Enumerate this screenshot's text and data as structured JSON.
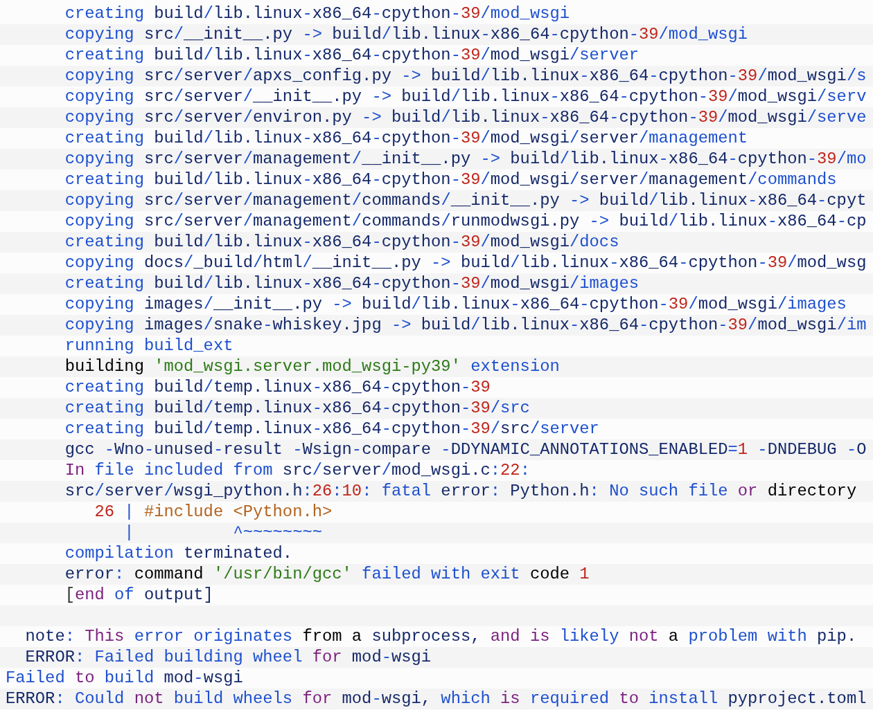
{
  "lines": [
    {
      "kind": "code",
      "tokens": [
        {
          "text": "      creating",
          "color": "#1d50cf"
        },
        {
          "text": " build",
          "color": "#15296a"
        },
        {
          "text": "/",
          "color": "#1d50cf"
        },
        {
          "text": "lib.linux",
          "color": "#15296a"
        },
        {
          "text": "-",
          "color": "#1d50cf"
        },
        {
          "text": "x86_64",
          "color": "#15296a"
        },
        {
          "text": "-",
          "color": "#1d50cf"
        },
        {
          "text": "cpython",
          "color": "#15296a"
        },
        {
          "text": "-",
          "color": "#1d50cf"
        },
        {
          "text": "39",
          "color": "#c0241b"
        },
        {
          "text": "/mod_wsgi",
          "color": "#1d50cf"
        }
      ]
    },
    {
      "kind": "code",
      "tokens": [
        {
          "text": "      copying",
          "color": "#1d50cf"
        },
        {
          "text": " src",
          "color": "#15296a"
        },
        {
          "text": "/",
          "color": "#1d50cf"
        },
        {
          "text": "__init__.py",
          "color": "#15296a"
        },
        {
          "text": " ->",
          "color": "#1d50cf"
        },
        {
          "text": " build",
          "color": "#15296a"
        },
        {
          "text": "/",
          "color": "#1d50cf"
        },
        {
          "text": "lib.linux",
          "color": "#15296a"
        },
        {
          "text": "-",
          "color": "#1d50cf"
        },
        {
          "text": "x86_64",
          "color": "#15296a"
        },
        {
          "text": "-",
          "color": "#1d50cf"
        },
        {
          "text": "cpython",
          "color": "#15296a"
        },
        {
          "text": "-",
          "color": "#1d50cf"
        },
        {
          "text": "39",
          "color": "#c0241b"
        },
        {
          "text": "/mod_wsgi",
          "color": "#1d50cf"
        }
      ]
    },
    {
      "kind": "code",
      "tokens": [
        {
          "text": "      creating",
          "color": "#1d50cf"
        },
        {
          "text": " build",
          "color": "#15296a"
        },
        {
          "text": "/",
          "color": "#1d50cf"
        },
        {
          "text": "lib.linux",
          "color": "#15296a"
        },
        {
          "text": "-",
          "color": "#1d50cf"
        },
        {
          "text": "x86_64",
          "color": "#15296a"
        },
        {
          "text": "-",
          "color": "#1d50cf"
        },
        {
          "text": "cpython",
          "color": "#15296a"
        },
        {
          "text": "-",
          "color": "#1d50cf"
        },
        {
          "text": "39",
          "color": "#c0241b"
        },
        {
          "text": "/",
          "color": "#1d50cf"
        },
        {
          "text": "mod_wsgi",
          "color": "#15296a"
        },
        {
          "text": "/server",
          "color": "#1d50cf"
        }
      ]
    },
    {
      "kind": "code",
      "tokens": [
        {
          "text": "      copying",
          "color": "#1d50cf"
        },
        {
          "text": " src",
          "color": "#15296a"
        },
        {
          "text": "/",
          "color": "#1d50cf"
        },
        {
          "text": "server",
          "color": "#15296a"
        },
        {
          "text": "/",
          "color": "#1d50cf"
        },
        {
          "text": "apxs_config.py",
          "color": "#15296a"
        },
        {
          "text": " ->",
          "color": "#1d50cf"
        },
        {
          "text": " build",
          "color": "#15296a"
        },
        {
          "text": "/",
          "color": "#1d50cf"
        },
        {
          "text": "lib.linux",
          "color": "#15296a"
        },
        {
          "text": "-",
          "color": "#1d50cf"
        },
        {
          "text": "x86_64",
          "color": "#15296a"
        },
        {
          "text": "-",
          "color": "#1d50cf"
        },
        {
          "text": "cpython",
          "color": "#15296a"
        },
        {
          "text": "-",
          "color": "#1d50cf"
        },
        {
          "text": "39",
          "color": "#c0241b"
        },
        {
          "text": "/",
          "color": "#1d50cf"
        },
        {
          "text": "mod_wsgi",
          "color": "#15296a"
        },
        {
          "text": "/s",
          "color": "#1d50cf"
        }
      ]
    },
    {
      "kind": "code",
      "tokens": [
        {
          "text": "      copying",
          "color": "#1d50cf"
        },
        {
          "text": " src",
          "color": "#15296a"
        },
        {
          "text": "/",
          "color": "#1d50cf"
        },
        {
          "text": "server",
          "color": "#15296a"
        },
        {
          "text": "/",
          "color": "#1d50cf"
        },
        {
          "text": "__init__.py",
          "color": "#15296a"
        },
        {
          "text": " ->",
          "color": "#1d50cf"
        },
        {
          "text": " build",
          "color": "#15296a"
        },
        {
          "text": "/",
          "color": "#1d50cf"
        },
        {
          "text": "lib.linux",
          "color": "#15296a"
        },
        {
          "text": "-",
          "color": "#1d50cf"
        },
        {
          "text": "x86_64",
          "color": "#15296a"
        },
        {
          "text": "-",
          "color": "#1d50cf"
        },
        {
          "text": "cpython",
          "color": "#15296a"
        },
        {
          "text": "-",
          "color": "#1d50cf"
        },
        {
          "text": "39",
          "color": "#c0241b"
        },
        {
          "text": "/",
          "color": "#1d50cf"
        },
        {
          "text": "mod_wsgi",
          "color": "#15296a"
        },
        {
          "text": "/serv",
          "color": "#1d50cf"
        }
      ]
    },
    {
      "kind": "code",
      "tokens": [
        {
          "text": "      copying",
          "color": "#1d50cf"
        },
        {
          "text": " src",
          "color": "#15296a"
        },
        {
          "text": "/",
          "color": "#1d50cf"
        },
        {
          "text": "server",
          "color": "#15296a"
        },
        {
          "text": "/",
          "color": "#1d50cf"
        },
        {
          "text": "environ.py",
          "color": "#15296a"
        },
        {
          "text": " ->",
          "color": "#1d50cf"
        },
        {
          "text": " build",
          "color": "#15296a"
        },
        {
          "text": "/",
          "color": "#1d50cf"
        },
        {
          "text": "lib.linux",
          "color": "#15296a"
        },
        {
          "text": "-",
          "color": "#1d50cf"
        },
        {
          "text": "x86_64",
          "color": "#15296a"
        },
        {
          "text": "-",
          "color": "#1d50cf"
        },
        {
          "text": "cpython",
          "color": "#15296a"
        },
        {
          "text": "-",
          "color": "#1d50cf"
        },
        {
          "text": "39",
          "color": "#c0241b"
        },
        {
          "text": "/",
          "color": "#1d50cf"
        },
        {
          "text": "mod_wsgi",
          "color": "#15296a"
        },
        {
          "text": "/serve",
          "color": "#1d50cf"
        }
      ]
    },
    {
      "kind": "code",
      "tokens": [
        {
          "text": "      creating",
          "color": "#1d50cf"
        },
        {
          "text": " build",
          "color": "#15296a"
        },
        {
          "text": "/",
          "color": "#1d50cf"
        },
        {
          "text": "lib.linux",
          "color": "#15296a"
        },
        {
          "text": "-",
          "color": "#1d50cf"
        },
        {
          "text": "x86_64",
          "color": "#15296a"
        },
        {
          "text": "-",
          "color": "#1d50cf"
        },
        {
          "text": "cpython",
          "color": "#15296a"
        },
        {
          "text": "-",
          "color": "#1d50cf"
        },
        {
          "text": "39",
          "color": "#c0241b"
        },
        {
          "text": "/",
          "color": "#1d50cf"
        },
        {
          "text": "mod_wsgi",
          "color": "#15296a"
        },
        {
          "text": "/",
          "color": "#1d50cf"
        },
        {
          "text": "server",
          "color": "#15296a"
        },
        {
          "text": "/management",
          "color": "#1d50cf"
        }
      ]
    },
    {
      "kind": "code",
      "tokens": [
        {
          "text": "      copying",
          "color": "#1d50cf"
        },
        {
          "text": " src",
          "color": "#15296a"
        },
        {
          "text": "/",
          "color": "#1d50cf"
        },
        {
          "text": "server",
          "color": "#15296a"
        },
        {
          "text": "/",
          "color": "#1d50cf"
        },
        {
          "text": "management",
          "color": "#15296a"
        },
        {
          "text": "/",
          "color": "#1d50cf"
        },
        {
          "text": "__init__.py",
          "color": "#15296a"
        },
        {
          "text": " ->",
          "color": "#1d50cf"
        },
        {
          "text": " build",
          "color": "#15296a"
        },
        {
          "text": "/",
          "color": "#1d50cf"
        },
        {
          "text": "lib.linux",
          "color": "#15296a"
        },
        {
          "text": "-",
          "color": "#1d50cf"
        },
        {
          "text": "x86_64",
          "color": "#15296a"
        },
        {
          "text": "-",
          "color": "#1d50cf"
        },
        {
          "text": "cpython",
          "color": "#15296a"
        },
        {
          "text": "-",
          "color": "#1d50cf"
        },
        {
          "text": "39",
          "color": "#c0241b"
        },
        {
          "text": "/mo",
          "color": "#1d50cf"
        }
      ]
    },
    {
      "kind": "code",
      "tokens": [
        {
          "text": "      creating",
          "color": "#1d50cf"
        },
        {
          "text": " build",
          "color": "#15296a"
        },
        {
          "text": "/",
          "color": "#1d50cf"
        },
        {
          "text": "lib.linux",
          "color": "#15296a"
        },
        {
          "text": "-",
          "color": "#1d50cf"
        },
        {
          "text": "x86_64",
          "color": "#15296a"
        },
        {
          "text": "-",
          "color": "#1d50cf"
        },
        {
          "text": "cpython",
          "color": "#15296a"
        },
        {
          "text": "-",
          "color": "#1d50cf"
        },
        {
          "text": "39",
          "color": "#c0241b"
        },
        {
          "text": "/",
          "color": "#1d50cf"
        },
        {
          "text": "mod_wsgi",
          "color": "#15296a"
        },
        {
          "text": "/",
          "color": "#1d50cf"
        },
        {
          "text": "server",
          "color": "#15296a"
        },
        {
          "text": "/",
          "color": "#1d50cf"
        },
        {
          "text": "management",
          "color": "#15296a"
        },
        {
          "text": "/commands",
          "color": "#1d50cf"
        }
      ]
    },
    {
      "kind": "code",
      "tokens": [
        {
          "text": "      copying",
          "color": "#1d50cf"
        },
        {
          "text": " src",
          "color": "#15296a"
        },
        {
          "text": "/",
          "color": "#1d50cf"
        },
        {
          "text": "server",
          "color": "#15296a"
        },
        {
          "text": "/",
          "color": "#1d50cf"
        },
        {
          "text": "management",
          "color": "#15296a"
        },
        {
          "text": "/",
          "color": "#1d50cf"
        },
        {
          "text": "commands",
          "color": "#15296a"
        },
        {
          "text": "/",
          "color": "#1d50cf"
        },
        {
          "text": "__init__.py",
          "color": "#15296a"
        },
        {
          "text": " ->",
          "color": "#1d50cf"
        },
        {
          "text": " build",
          "color": "#15296a"
        },
        {
          "text": "/",
          "color": "#1d50cf"
        },
        {
          "text": "lib.linux",
          "color": "#15296a"
        },
        {
          "text": "-",
          "color": "#1d50cf"
        },
        {
          "text": "x86_64",
          "color": "#15296a"
        },
        {
          "text": "-",
          "color": "#1d50cf"
        },
        {
          "text": "cpyt",
          "color": "#15296a"
        }
      ]
    },
    {
      "kind": "code",
      "tokens": [
        {
          "text": "      copying",
          "color": "#1d50cf"
        },
        {
          "text": " src",
          "color": "#15296a"
        },
        {
          "text": "/",
          "color": "#1d50cf"
        },
        {
          "text": "server",
          "color": "#15296a"
        },
        {
          "text": "/",
          "color": "#1d50cf"
        },
        {
          "text": "management",
          "color": "#15296a"
        },
        {
          "text": "/",
          "color": "#1d50cf"
        },
        {
          "text": "commands",
          "color": "#15296a"
        },
        {
          "text": "/",
          "color": "#1d50cf"
        },
        {
          "text": "runmodwsgi.py",
          "color": "#15296a"
        },
        {
          "text": " ->",
          "color": "#1d50cf"
        },
        {
          "text": " build",
          "color": "#15296a"
        },
        {
          "text": "/",
          "color": "#1d50cf"
        },
        {
          "text": "lib.linux",
          "color": "#15296a"
        },
        {
          "text": "-",
          "color": "#1d50cf"
        },
        {
          "text": "x86_64",
          "color": "#15296a"
        },
        {
          "text": "-",
          "color": "#1d50cf"
        },
        {
          "text": "cp",
          "color": "#15296a"
        }
      ]
    },
    {
      "kind": "code",
      "tokens": [
        {
          "text": "      creating",
          "color": "#1d50cf"
        },
        {
          "text": " build",
          "color": "#15296a"
        },
        {
          "text": "/",
          "color": "#1d50cf"
        },
        {
          "text": "lib.linux",
          "color": "#15296a"
        },
        {
          "text": "-",
          "color": "#1d50cf"
        },
        {
          "text": "x86_64",
          "color": "#15296a"
        },
        {
          "text": "-",
          "color": "#1d50cf"
        },
        {
          "text": "cpython",
          "color": "#15296a"
        },
        {
          "text": "-",
          "color": "#1d50cf"
        },
        {
          "text": "39",
          "color": "#c0241b"
        },
        {
          "text": "/",
          "color": "#1d50cf"
        },
        {
          "text": "mod_wsgi",
          "color": "#15296a"
        },
        {
          "text": "/docs",
          "color": "#1d50cf"
        }
      ]
    },
    {
      "kind": "code",
      "tokens": [
        {
          "text": "      copying",
          "color": "#1d50cf"
        },
        {
          "text": " docs",
          "color": "#15296a"
        },
        {
          "text": "/",
          "color": "#1d50cf"
        },
        {
          "text": "_build",
          "color": "#15296a"
        },
        {
          "text": "/",
          "color": "#1d50cf"
        },
        {
          "text": "html",
          "color": "#15296a"
        },
        {
          "text": "/",
          "color": "#1d50cf"
        },
        {
          "text": "__init__.py",
          "color": "#15296a"
        },
        {
          "text": " ->",
          "color": "#1d50cf"
        },
        {
          "text": " build",
          "color": "#15296a"
        },
        {
          "text": "/",
          "color": "#1d50cf"
        },
        {
          "text": "lib.linux",
          "color": "#15296a"
        },
        {
          "text": "-",
          "color": "#1d50cf"
        },
        {
          "text": "x86_64",
          "color": "#15296a"
        },
        {
          "text": "-",
          "color": "#1d50cf"
        },
        {
          "text": "cpython",
          "color": "#15296a"
        },
        {
          "text": "-",
          "color": "#1d50cf"
        },
        {
          "text": "39",
          "color": "#c0241b"
        },
        {
          "text": "/",
          "color": "#1d50cf"
        },
        {
          "text": "mod_wsg",
          "color": "#15296a"
        }
      ]
    },
    {
      "kind": "code",
      "tokens": [
        {
          "text": "      creating",
          "color": "#1d50cf"
        },
        {
          "text": " build",
          "color": "#15296a"
        },
        {
          "text": "/",
          "color": "#1d50cf"
        },
        {
          "text": "lib.linux",
          "color": "#15296a"
        },
        {
          "text": "-",
          "color": "#1d50cf"
        },
        {
          "text": "x86_64",
          "color": "#15296a"
        },
        {
          "text": "-",
          "color": "#1d50cf"
        },
        {
          "text": "cpython",
          "color": "#15296a"
        },
        {
          "text": "-",
          "color": "#1d50cf"
        },
        {
          "text": "39",
          "color": "#c0241b"
        },
        {
          "text": "/",
          "color": "#1d50cf"
        },
        {
          "text": "mod_wsgi",
          "color": "#15296a"
        },
        {
          "text": "/images",
          "color": "#1d50cf"
        }
      ]
    },
    {
      "kind": "code",
      "tokens": [
        {
          "text": "      copying",
          "color": "#1d50cf"
        },
        {
          "text": " images",
          "color": "#15296a"
        },
        {
          "text": "/",
          "color": "#1d50cf"
        },
        {
          "text": "__init__.py",
          "color": "#15296a"
        },
        {
          "text": " ->",
          "color": "#1d50cf"
        },
        {
          "text": " build",
          "color": "#15296a"
        },
        {
          "text": "/",
          "color": "#1d50cf"
        },
        {
          "text": "lib.linux",
          "color": "#15296a"
        },
        {
          "text": "-",
          "color": "#1d50cf"
        },
        {
          "text": "x86_64",
          "color": "#15296a"
        },
        {
          "text": "-",
          "color": "#1d50cf"
        },
        {
          "text": "cpython",
          "color": "#15296a"
        },
        {
          "text": "-",
          "color": "#1d50cf"
        },
        {
          "text": "39",
          "color": "#c0241b"
        },
        {
          "text": "/",
          "color": "#1d50cf"
        },
        {
          "text": "mod_wsgi",
          "color": "#15296a"
        },
        {
          "text": "/images",
          "color": "#1d50cf"
        }
      ]
    },
    {
      "kind": "code",
      "tokens": [
        {
          "text": "      copying",
          "color": "#1d50cf"
        },
        {
          "text": " images",
          "color": "#15296a"
        },
        {
          "text": "/",
          "color": "#1d50cf"
        },
        {
          "text": "snake",
          "color": "#15296a"
        },
        {
          "text": "-",
          "color": "#1d50cf"
        },
        {
          "text": "whiskey.jpg",
          "color": "#15296a"
        },
        {
          "text": " ->",
          "color": "#1d50cf"
        },
        {
          "text": " build",
          "color": "#15296a"
        },
        {
          "text": "/",
          "color": "#1d50cf"
        },
        {
          "text": "lib.linux",
          "color": "#15296a"
        },
        {
          "text": "-",
          "color": "#1d50cf"
        },
        {
          "text": "x86_64",
          "color": "#15296a"
        },
        {
          "text": "-",
          "color": "#1d50cf"
        },
        {
          "text": "cpython",
          "color": "#15296a"
        },
        {
          "text": "-",
          "color": "#1d50cf"
        },
        {
          "text": "39",
          "color": "#c0241b"
        },
        {
          "text": "/",
          "color": "#1d50cf"
        },
        {
          "text": "mod_wsgi",
          "color": "#15296a"
        },
        {
          "text": "/im",
          "color": "#1d50cf"
        }
      ]
    },
    {
      "kind": "code",
      "tokens": [
        {
          "text": "      running build_ext",
          "color": "#1d50cf"
        }
      ]
    },
    {
      "kind": "code",
      "tokens": [
        {
          "text": "      building",
          "color": "#000000"
        },
        {
          "text": " 'mod_wsgi.server.mod_wsgi-py39'",
          "color": "#2d7a17"
        },
        {
          "text": " extension",
          "color": "#1d50cf"
        }
      ]
    },
    {
      "kind": "code",
      "tokens": [
        {
          "text": "      creating",
          "color": "#1d50cf"
        },
        {
          "text": " build",
          "color": "#15296a"
        },
        {
          "text": "/",
          "color": "#1d50cf"
        },
        {
          "text": "temp.linux",
          "color": "#15296a"
        },
        {
          "text": "-",
          "color": "#1d50cf"
        },
        {
          "text": "x86_64",
          "color": "#15296a"
        },
        {
          "text": "-",
          "color": "#1d50cf"
        },
        {
          "text": "cpython",
          "color": "#15296a"
        },
        {
          "text": "-",
          "color": "#1d50cf"
        },
        {
          "text": "39",
          "color": "#c0241b"
        }
      ]
    },
    {
      "kind": "code",
      "tokens": [
        {
          "text": "      creating",
          "color": "#1d50cf"
        },
        {
          "text": " build",
          "color": "#15296a"
        },
        {
          "text": "/",
          "color": "#1d50cf"
        },
        {
          "text": "temp.linux",
          "color": "#15296a"
        },
        {
          "text": "-",
          "color": "#1d50cf"
        },
        {
          "text": "x86_64",
          "color": "#15296a"
        },
        {
          "text": "-",
          "color": "#1d50cf"
        },
        {
          "text": "cpython",
          "color": "#15296a"
        },
        {
          "text": "-",
          "color": "#1d50cf"
        },
        {
          "text": "39",
          "color": "#c0241b"
        },
        {
          "text": "/src",
          "color": "#1d50cf"
        }
      ]
    },
    {
      "kind": "code",
      "tokens": [
        {
          "text": "      creating",
          "color": "#1d50cf"
        },
        {
          "text": " build",
          "color": "#15296a"
        },
        {
          "text": "/",
          "color": "#1d50cf"
        },
        {
          "text": "temp.linux",
          "color": "#15296a"
        },
        {
          "text": "-",
          "color": "#1d50cf"
        },
        {
          "text": "x86_64",
          "color": "#15296a"
        },
        {
          "text": "-",
          "color": "#1d50cf"
        },
        {
          "text": "cpython",
          "color": "#15296a"
        },
        {
          "text": "-",
          "color": "#1d50cf"
        },
        {
          "text": "39",
          "color": "#c0241b"
        },
        {
          "text": "/",
          "color": "#1d50cf"
        },
        {
          "text": "src",
          "color": "#15296a"
        },
        {
          "text": "/server",
          "color": "#1d50cf"
        }
      ]
    },
    {
      "kind": "code",
      "tokens": [
        {
          "text": "      gcc",
          "color": "#15296a"
        },
        {
          "text": " -",
          "color": "#1d50cf"
        },
        {
          "text": "Wno",
          "color": "#15296a"
        },
        {
          "text": "-",
          "color": "#1d50cf"
        },
        {
          "text": "unused",
          "color": "#15296a"
        },
        {
          "text": "-",
          "color": "#1d50cf"
        },
        {
          "text": "result",
          "color": "#15296a"
        },
        {
          "text": " -",
          "color": "#1d50cf"
        },
        {
          "text": "Wsign",
          "color": "#15296a"
        },
        {
          "text": "-",
          "color": "#1d50cf"
        },
        {
          "text": "compare",
          "color": "#15296a"
        },
        {
          "text": " -",
          "color": "#1d50cf"
        },
        {
          "text": "DDYNAMIC_ANNOTATIONS_ENABLED",
          "color": "#15296a"
        },
        {
          "text": "=",
          "color": "#1d50cf"
        },
        {
          "text": "1",
          "color": "#c0241b"
        },
        {
          "text": " -",
          "color": "#1d50cf"
        },
        {
          "text": "DNDEBUG",
          "color": "#15296a"
        },
        {
          "text": " -",
          "color": "#1d50cf"
        },
        {
          "text": "O",
          "color": "#15296a"
        }
      ]
    },
    {
      "kind": "code",
      "tokens": [
        {
          "text": "      In",
          "color": "#7b1f7e"
        },
        {
          "text": " file included from",
          "color": "#1d50cf"
        },
        {
          "text": " src",
          "color": "#15296a"
        },
        {
          "text": "/",
          "color": "#1d50cf"
        },
        {
          "text": "server",
          "color": "#15296a"
        },
        {
          "text": "/",
          "color": "#1d50cf"
        },
        {
          "text": "mod_wsgi.c",
          "color": "#15296a"
        },
        {
          "text": ":",
          "color": "#1d50cf"
        },
        {
          "text": "22",
          "color": "#c0241b"
        },
        {
          "text": ":",
          "color": "#1d50cf"
        }
      ]
    },
    {
      "kind": "code",
      "tokens": [
        {
          "text": "      src",
          "color": "#15296a"
        },
        {
          "text": "/",
          "color": "#1d50cf"
        },
        {
          "text": "server",
          "color": "#15296a"
        },
        {
          "text": "/",
          "color": "#1d50cf"
        },
        {
          "text": "wsgi_python.h",
          "color": "#15296a"
        },
        {
          "text": ":",
          "color": "#1d50cf"
        },
        {
          "text": "26",
          "color": "#c0241b"
        },
        {
          "text": ":",
          "color": "#1d50cf"
        },
        {
          "text": "10",
          "color": "#c0241b"
        },
        {
          "text": ": fatal",
          "color": "#1d50cf"
        },
        {
          "text": " error",
          "color": "#15296a"
        },
        {
          "text": ":",
          "color": "#1d50cf"
        },
        {
          "text": " Python.h",
          "color": "#15296a"
        },
        {
          "text": ": No such file",
          "color": "#1d50cf"
        },
        {
          "text": " or",
          "color": "#7b1f7e"
        },
        {
          "text": " directory",
          "color": "#000000"
        }
      ]
    },
    {
      "kind": "code",
      "tokens": [
        {
          "text": "         26",
          "color": "#c0241b"
        },
        {
          "text": " |",
          "color": "#1d50cf"
        },
        {
          "text": " #include <Python.h>",
          "color": "#b3631f"
        }
      ]
    },
    {
      "kind": "code",
      "tokens": [
        {
          "text": "            |          ^~~~~~~~~",
          "color": "#1d50cf"
        }
      ]
    },
    {
      "kind": "code",
      "tokens": [
        {
          "text": "      compilation",
          "color": "#1d50cf"
        },
        {
          "text": " terminated.",
          "color": "#15296a"
        }
      ]
    },
    {
      "kind": "code",
      "tokens": [
        {
          "text": "      error",
          "color": "#15296a"
        },
        {
          "text": ":",
          "color": "#1d50cf"
        },
        {
          "text": " command",
          "color": "#000000"
        },
        {
          "text": " '/usr/bin/gcc'",
          "color": "#2d7a17"
        },
        {
          "text": " failed with exit",
          "color": "#1d50cf"
        },
        {
          "text": " code",
          "color": "#000000"
        },
        {
          "text": " 1",
          "color": "#c0241b"
        }
      ]
    },
    {
      "kind": "code",
      "tokens": [
        {
          "text": "      [",
          "color": "#333333"
        },
        {
          "text": "end",
          "color": "#7b1f7e"
        },
        {
          "text": " of",
          "color": "#1d50cf"
        },
        {
          "text": " output]",
          "color": "#15296a"
        }
      ]
    },
    {
      "kind": "blank"
    },
    {
      "kind": "code",
      "tokens": [
        {
          "text": "  note",
          "color": "#15296a"
        },
        {
          "text": ":",
          "color": "#1d50cf"
        },
        {
          "text": " This",
          "color": "#7b1f7e"
        },
        {
          "text": " error originates",
          "color": "#1d50cf"
        },
        {
          "text": " from a",
          "color": "#000000"
        },
        {
          "text": " subprocess,",
          "color": "#15296a"
        },
        {
          "text": " and is",
          "color": "#7b1f7e"
        },
        {
          "text": " likely",
          "color": "#1d50cf"
        },
        {
          "text": " not",
          "color": "#7b1f7e"
        },
        {
          "text": " a",
          "color": "#000000"
        },
        {
          "text": " problem with",
          "color": "#1d50cf"
        },
        {
          "text": " pip.",
          "color": "#15296a"
        }
      ]
    },
    {
      "kind": "code",
      "tokens": [
        {
          "text": "  ERROR",
          "color": "#15296a"
        },
        {
          "text": ": Failed building wheel",
          "color": "#1d50cf"
        },
        {
          "text": " for",
          "color": "#7b1f7e"
        },
        {
          "text": " mod",
          "color": "#15296a"
        },
        {
          "text": "-",
          "color": "#1d50cf"
        },
        {
          "text": "wsgi",
          "color": "#15296a"
        }
      ]
    },
    {
      "kind": "code",
      "tokens": [
        {
          "text": "Failed",
          "color": "#1d50cf"
        },
        {
          "text": " to",
          "color": "#7b1f7e"
        },
        {
          "text": " build",
          "color": "#1d50cf"
        },
        {
          "text": " mod",
          "color": "#15296a"
        },
        {
          "text": "-",
          "color": "#1d50cf"
        },
        {
          "text": "wsgi",
          "color": "#15296a"
        }
      ]
    },
    {
      "kind": "code",
      "tokens": [
        {
          "text": "ERROR",
          "color": "#15296a"
        },
        {
          "text": ": Could",
          "color": "#1d50cf"
        },
        {
          "text": " not",
          "color": "#7b1f7e"
        },
        {
          "text": " build wheels",
          "color": "#1d50cf"
        },
        {
          "text": " for",
          "color": "#7b1f7e"
        },
        {
          "text": " mod",
          "color": "#15296a"
        },
        {
          "text": "-",
          "color": "#1d50cf"
        },
        {
          "text": "wsgi,",
          "color": "#15296a"
        },
        {
          "text": " which",
          "color": "#1d50cf"
        },
        {
          "text": " is",
          "color": "#7b1f7e"
        },
        {
          "text": " required",
          "color": "#1d50cf"
        },
        {
          "text": " to",
          "color": "#7b1f7e"
        },
        {
          "text": " install",
          "color": "#1d50cf"
        },
        {
          "text": " pyproject.toml",
          "color": "#15296a"
        }
      ]
    }
  ]
}
